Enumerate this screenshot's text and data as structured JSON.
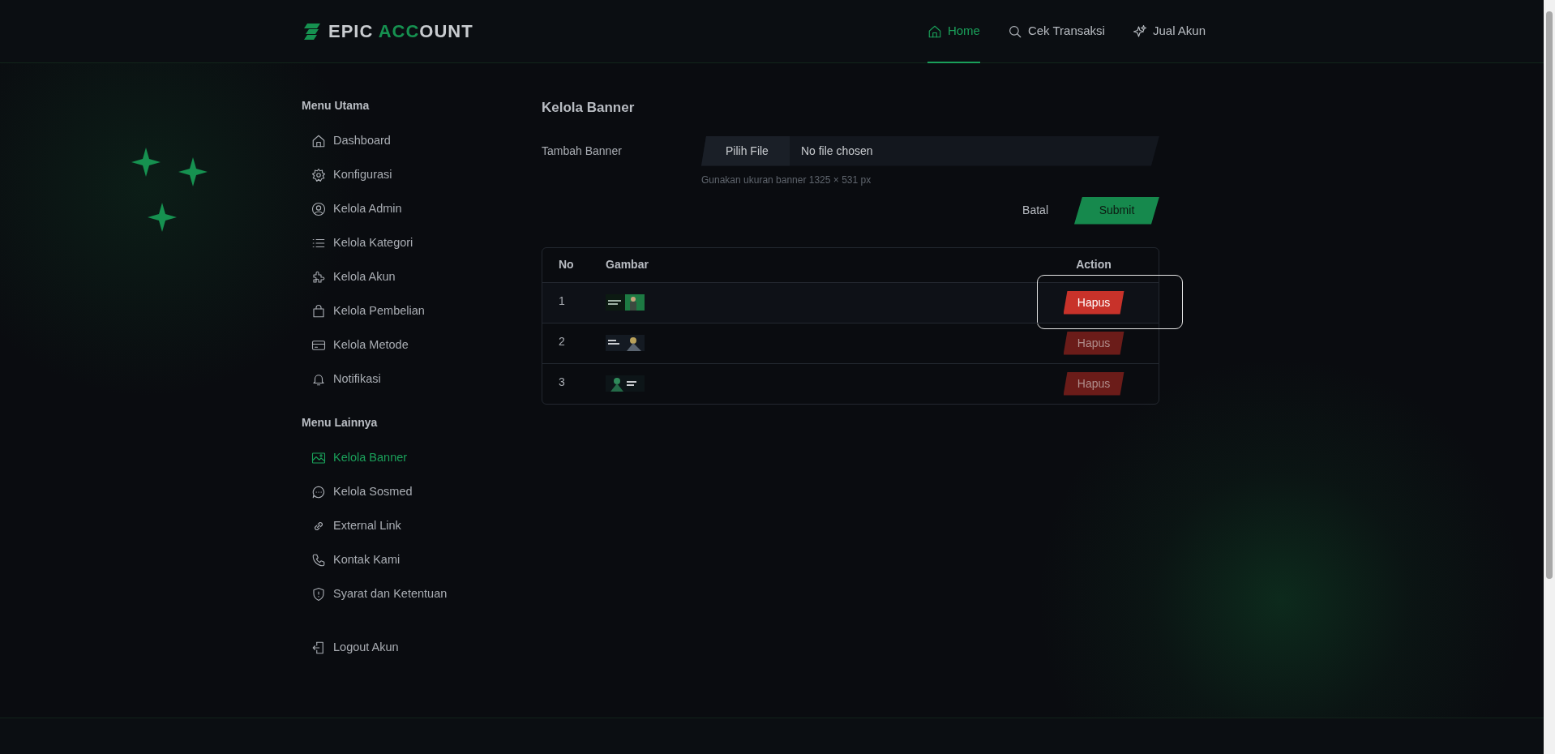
{
  "header": {
    "logo": [
      {
        "text": "EPIC ",
        "accent": false
      },
      {
        "text": "ACC",
        "accent": true
      },
      {
        "text": "OUNT",
        "accent": false
      }
    ],
    "nav": [
      {
        "label": "Home",
        "selected": true
      },
      {
        "label": "Cek Transaksi",
        "selected": false
      },
      {
        "label": "Jual Akun",
        "selected": false
      }
    ]
  },
  "sidebar": {
    "sections": [
      {
        "title": "Menu Utama",
        "items": [
          {
            "label": "Dashboard",
            "selected": false
          },
          {
            "label": "Konfigurasi",
            "selected": false
          },
          {
            "label": "Kelola Admin",
            "selected": false
          },
          {
            "label": "Kelola Kategori",
            "selected": false
          },
          {
            "label": "Kelola Akun",
            "selected": false
          },
          {
            "label": "Kelola Pembelian",
            "selected": false
          },
          {
            "label": "Kelola Metode",
            "selected": false
          },
          {
            "label": "Notifikasi",
            "selected": false
          }
        ]
      },
      {
        "title": "Menu Lainnya",
        "items": [
          {
            "label": "Kelola Banner",
            "selected": true
          },
          {
            "label": "Kelola Sosmed",
            "selected": false
          },
          {
            "label": "External Link",
            "selected": false
          },
          {
            "label": "Kontak Kami",
            "selected": false
          },
          {
            "label": "Syarat dan Ketentuan",
            "selected": false
          }
        ]
      }
    ],
    "logout": "Logout Akun"
  },
  "main": {
    "title": "Kelola Banner",
    "form": {
      "label": "Tambah Banner",
      "file_button": "Pilih File",
      "file_status": "No file chosen",
      "hint": "Gunakan ukuran banner 1325 × 531 px",
      "cancel": "Batal",
      "submit": "Submit"
    },
    "table": {
      "columns": [
        "No",
        "Gambar",
        "Action"
      ],
      "rows": [
        {
          "no": "1",
          "action": "Hapus",
          "focused": true
        },
        {
          "no": "2",
          "action": "Hapus",
          "focused": false
        },
        {
          "no": "3",
          "action": "Hapus",
          "focused": false
        }
      ]
    }
  }
}
